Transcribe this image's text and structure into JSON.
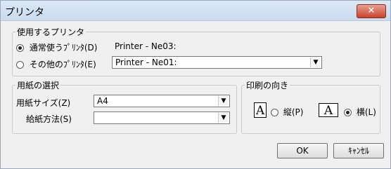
{
  "window": {
    "title": "プリンタ",
    "close_label": "✕"
  },
  "printer_group": {
    "legend": "使用するプリンタ",
    "default_label": "通常使うﾌﾟﾘﾝﾀ(D)",
    "default_value": "Printer - Ne03:",
    "other_label": "その他のﾌﾟﾘﾝﾀ(E)",
    "other_value": "Printer - Ne01:"
  },
  "paper_group": {
    "legend": "用紙の選択",
    "size_label": "用紙サイズ(Z)",
    "size_value": "A4",
    "feed_label": "給紙方法(S)",
    "feed_value": ""
  },
  "orientation_group": {
    "legend": "印刷の向き",
    "portrait_label": "縦(P)",
    "landscape_label": "横(L)",
    "icon_letter": "A"
  },
  "buttons": {
    "ok": "OK",
    "cancel": "ｷｬﾝｾﾙ"
  },
  "colors": {
    "titlebar": "#c9dbee",
    "close": "#c8442e"
  }
}
